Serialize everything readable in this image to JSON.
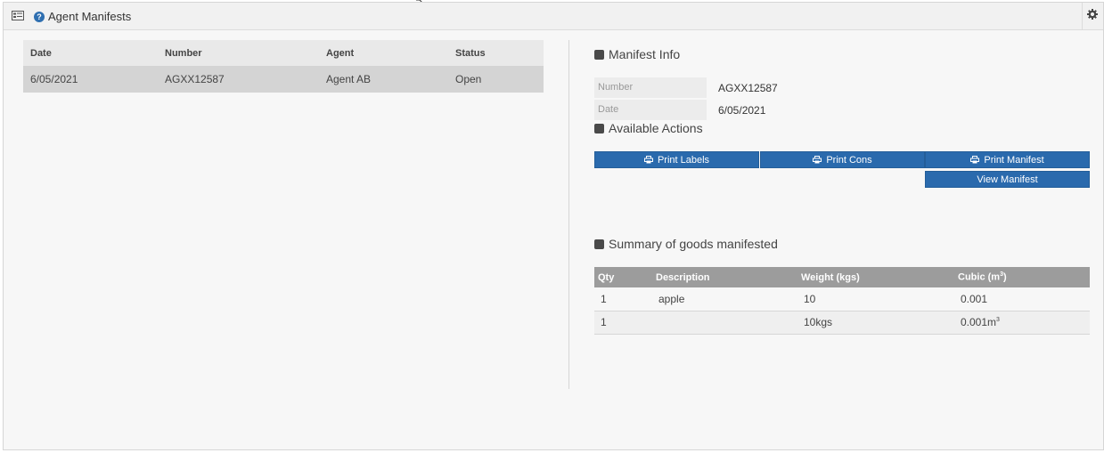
{
  "header": {
    "title": "Agent Manifests",
    "help_glyph": "?",
    "icons": [
      "list-icon",
      "help-icon",
      "gear-icon"
    ]
  },
  "manifests_table": {
    "columns": [
      "Date",
      "Number",
      "Agent",
      "Status"
    ],
    "rows": [
      {
        "date": "6/05/2021",
        "number": "AGXX12587",
        "agent": "Agent AB",
        "status": "Open"
      }
    ]
  },
  "manifest_info": {
    "title": "Manifest Info",
    "number_label": "Number",
    "number_value": "AGXX12587",
    "date_label": "Date",
    "date_value": "6/05/2021"
  },
  "actions": {
    "title": "Available Actions",
    "print_labels": "Print Labels",
    "print_cons": "Print Cons",
    "print_manifest": "Print Manifest",
    "view_manifest": "View Manifest"
  },
  "summary": {
    "title": "Summary of goods manifested",
    "columns": {
      "qty": "Qty",
      "description": "Description",
      "weight": "Weight (kgs)",
      "cubic": "Cubic (m",
      "cubic_sup": "3",
      "cubic_close": ")"
    },
    "rows": [
      {
        "qty": "1",
        "description": "apple",
        "weight": "10",
        "cubic": "0.001"
      }
    ],
    "total": {
      "qty": "1",
      "description": "",
      "weight": "10kgs",
      "cubic": "0.001m",
      "cubic_sup": "3"
    }
  },
  "colors": {
    "button": "#2a6aad",
    "summary_header": "#9c9c9c",
    "selected_row": "#d4d4d4"
  }
}
